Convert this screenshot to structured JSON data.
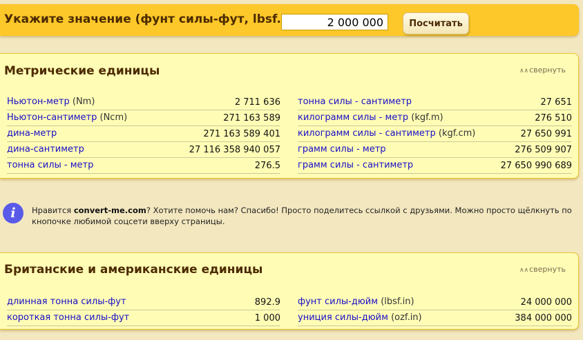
{
  "header": {
    "prompt": "Укажите значение (фунт силы-фут, lbsf.ft):",
    "input_value": "2 000 000",
    "calculate_label": "Посчитать"
  },
  "metric": {
    "title": "Метрические единицы",
    "collapse_label": "свернуть",
    "left": [
      {
        "name": "Ньютон-метр",
        "abbr": " (Nm)",
        "value": "2 711 636"
      },
      {
        "name": "Ньютон-сантиметр",
        "abbr": " (Ncm)",
        "value": "271 163 589"
      },
      {
        "name": "дина-метр",
        "abbr": "",
        "value": "271 163 589 401"
      },
      {
        "name": "дина-сантиметр",
        "abbr": "",
        "value": "27 116 358 940 057"
      },
      {
        "name": "тонна силы - метр",
        "abbr": "",
        "value": "276.5"
      }
    ],
    "right": [
      {
        "name": "тонна силы - сантиметр",
        "abbr": "",
        "value": "27 651"
      },
      {
        "name": "килограмм силы - метр",
        "abbr": " (kgf.m)",
        "value": "276 510"
      },
      {
        "name": "килограмм силы - сантиметр",
        "abbr": " (kgf.cm)",
        "value": "27 650 991"
      },
      {
        "name": "грамм силы - метр",
        "abbr": "",
        "value": "276 509 907"
      },
      {
        "name": "грамм силы - сантиметр",
        "abbr": "",
        "value": "27 650 990 689"
      }
    ]
  },
  "info": {
    "prefix": "Нравится ",
    "site": "convert-me.com",
    "text": "? Хотите помочь нам? Спасибо! Просто поделитесь ссылкой с друзьями. Можно просто щёлкнуть по кнопочке любимой соцсети вверху страницы."
  },
  "british": {
    "title": "Британские и американские единицы",
    "collapse_label": "свернуть",
    "left": [
      {
        "name": "длинная тонна силы-фут",
        "abbr": "",
        "value": "892.9"
      },
      {
        "name": "короткая тонна силы-фут",
        "abbr": "",
        "value": "1 000"
      }
    ],
    "right": [
      {
        "name": "фунт силы-дюйм",
        "abbr": " (lbsf.in)",
        "value": "24 000 000"
      },
      {
        "name": "униция силы-дюйм",
        "abbr": " (ozf.in)",
        "value": "384 000 000"
      }
    ]
  }
}
